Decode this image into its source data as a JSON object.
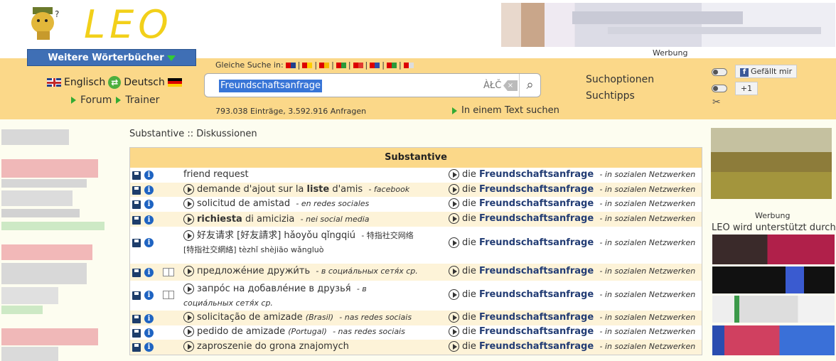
{
  "header": {
    "logo_text": "LEO",
    "ad_label": "Werbung",
    "dictionaries_button": "Weitere Wörterbücher"
  },
  "lang": {
    "left": "Englisch",
    "right": "Deutsch",
    "forum": "Forum",
    "trainer": "Trainer"
  },
  "search": {
    "same_search_label": "Gleiche Suche in:",
    "value": "Freundschaftsanfrage",
    "special_chars": "ÀŁČ",
    "stats": "793.038 Einträge, 3.592.916 Anfragen",
    "text_search": "In einem Text suchen"
  },
  "options": {
    "search_options": "Suchoptionen",
    "search_tips": "Suchtipps",
    "like": "Gefällt mir",
    "plus_one": "+1"
  },
  "main": {
    "breadcrumb": "Substantive :: Diskussionen",
    "table_title": "Substantive",
    "rows": [
      {
        "src": "friend request",
        "note": "",
        "article": "die",
        "word": "Freundschaftsanfrage",
        "context": "- in sozialen Netzwerken"
      },
      {
        "src_pre": "demande d'ajout sur la ",
        "src_bold": "liste",
        "src_post": " d'amis",
        "note": "- facebook",
        "article": "die",
        "word": "Freundschaftsanfrage",
        "context": "- in sozialen Netzwerken"
      },
      {
        "src": "solicitud de amistad",
        "note": "- en redes sociales",
        "article": "die",
        "word": "Freundschaftsanfrage",
        "context": "- in sozialen Netzwerken"
      },
      {
        "src_bold": "richiesta",
        "src_post": " di amicizia",
        "note": "- nei social media",
        "article": "die",
        "word": "Freundschaftsanfrage",
        "context": "- in sozialen Netzwerken"
      },
      {
        "src": "好友请求 [好友請求] hǎoyǒu qǐngqiú",
        "note": "- 特指社交网络 [特指社交網絡] tèzhǐ shèjiāo wǎngluò",
        "article": "die",
        "word": "Freundschaftsanfrage",
        "context": "- in sozialen Netzwerken"
      },
      {
        "src": "предложе́ние дружи́ть",
        "note": "- в социа́льных сетя́х ср.",
        "article": "die",
        "word": "Freundschaftsanfrage",
        "context": "- in sozialen Netzwerken"
      },
      {
        "src": "запро́с на добавле́ние в друзья́",
        "note": "- в социа́льных сетя́х ср.",
        "article": "die",
        "word": "Freundschaftsanfrage",
        "context": "- in sozialen Netzwerken"
      },
      {
        "src": "solicitação de amizade",
        "src_note": "(Brasil)",
        "note": "- nas redes sociais",
        "article": "die",
        "word": "Freundschaftsanfrage",
        "context": "- in sozialen Netzwerken"
      },
      {
        "src": "pedido de amizade",
        "src_note": "(Portugal)",
        "note": "- nas redes sociais",
        "article": "die",
        "word": "Freundschaftsanfrage",
        "context": "- in sozialen Netzwerken"
      },
      {
        "src": "zaproszenie do grona znajomych",
        "note": "",
        "article": "die",
        "word": "Freundschaftsanfrage",
        "context": "- in sozialen Netzwerken"
      }
    ]
  },
  "right": {
    "ad_label": "Werbung",
    "supported": "LEO wird unterstützt durch"
  },
  "colors": {
    "band": "#fbd889",
    "button": "#3f6fb5",
    "logo": "#f2d01a",
    "link_bold": "#223c74"
  }
}
